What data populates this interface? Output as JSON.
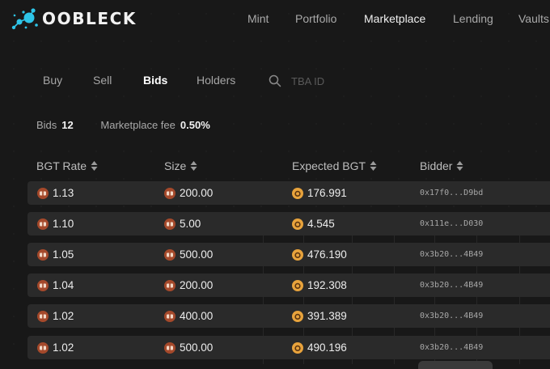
{
  "app": {
    "name": "OOBLECK"
  },
  "nav": {
    "items": [
      {
        "label": "Mint",
        "active": false
      },
      {
        "label": "Portfolio",
        "active": false
      },
      {
        "label": "Marketplace",
        "active": true
      },
      {
        "label": "Lending",
        "active": false
      },
      {
        "label": "Vaults",
        "active": false
      }
    ]
  },
  "tabs": {
    "items": [
      {
        "label": "Buy",
        "active": false
      },
      {
        "label": "Sell",
        "active": false
      },
      {
        "label": "Bids",
        "active": true
      },
      {
        "label": "Holders",
        "active": false
      }
    ]
  },
  "search": {
    "placeholder": "TBA ID",
    "value": "",
    "icon": "search-icon"
  },
  "stats": {
    "bids_label": "Bids",
    "bids_value": "12",
    "fee_label": "Marketplace fee",
    "fee_value": "0.50%"
  },
  "table": {
    "columns": [
      "BGT Rate",
      "Size",
      "Expected BGT",
      "Bidder"
    ],
    "sort_icon": "sort-icon",
    "rows": [
      {
        "rate": "1.13",
        "size": "200.00",
        "expected": "176.991",
        "bidder": "0x17f0...D9bd"
      },
      {
        "rate": "1.10",
        "size": "5.00",
        "expected": "4.545",
        "bidder": "0x111e...D030"
      },
      {
        "rate": "1.05",
        "size": "500.00",
        "expected": "476.190",
        "bidder": "0x3b20...4B49"
      },
      {
        "rate": "1.04",
        "size": "200.00",
        "expected": "192.308",
        "bidder": "0x3b20...4B49"
      },
      {
        "rate": "1.02",
        "size": "400.00",
        "expected": "391.389",
        "bidder": "0x3b20...4B49"
      },
      {
        "rate": "1.02",
        "size": "500.00",
        "expected": "490.196",
        "bidder": "0x3b20...4B49"
      }
    ]
  },
  "colors": {
    "background": "#181818",
    "row_background": "#2a2a2a",
    "logo_accent": "#2ec5e8",
    "token_orange": "#e8a33c",
    "token_brown": "#a5492b"
  },
  "icons": {
    "rate_icon": "honey-token-icon",
    "size_icon": "honey-token-icon",
    "expected_icon": "bgt-coin-icon"
  }
}
